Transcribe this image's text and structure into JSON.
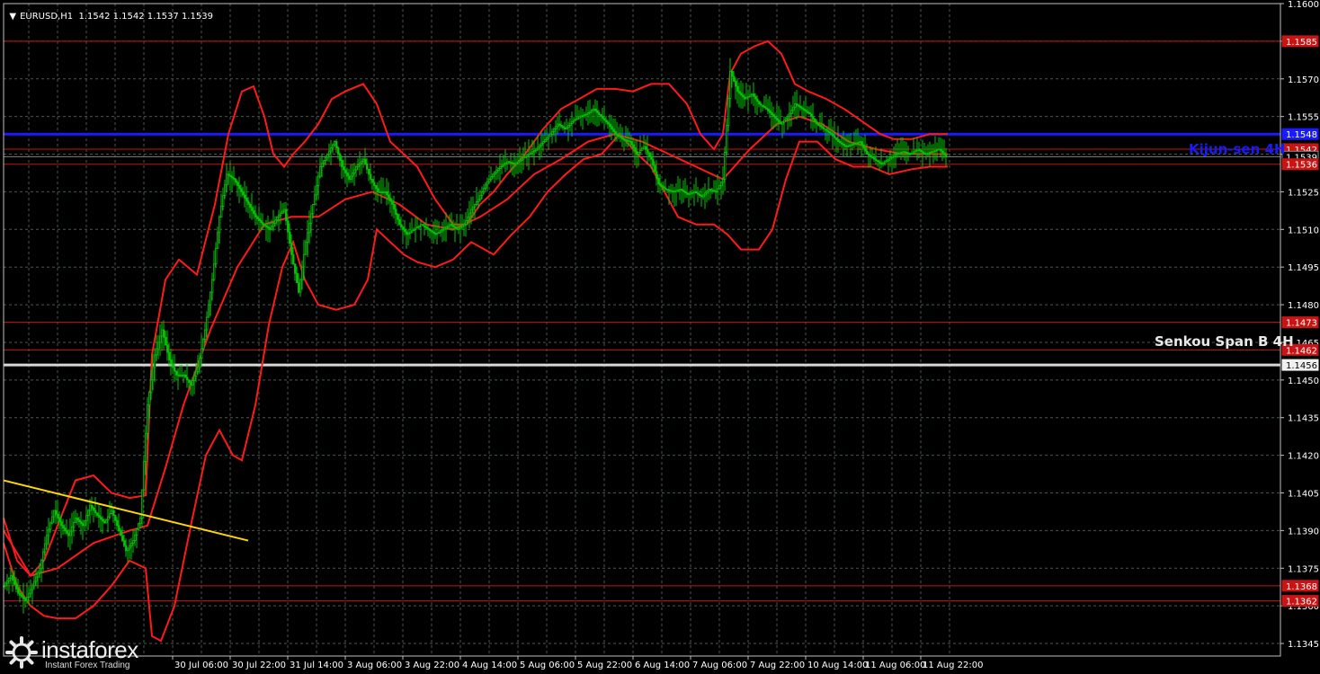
{
  "header": {
    "symbol": "EURUSD,H1",
    "ohlc": "1.1542 1.1542 1.1537 1.1539"
  },
  "logo": {
    "brand": "instaforex",
    "tagline": "Instant Forex Trading"
  },
  "colors": {
    "background": "#000000",
    "grid": "#4a5a4a",
    "candle": "#00c800",
    "bollinger": "#ff1a1a",
    "level_line": "#c81414",
    "kijun": "#1a1aff",
    "senkou": "#d8d8d8",
    "trendline": "#ffd700",
    "axis_text": "#ffffff"
  },
  "chart_data": {
    "type": "candlestick",
    "title": "EURUSD,H1",
    "ylim": [
      1.134,
      1.16
    ],
    "y_ticks": [
      "1.1600",
      "1.1585",
      "1.1570",
      "1.1555",
      "1.1540",
      "1.1525",
      "1.1510",
      "1.1495",
      "1.1480",
      "1.1465",
      "1.1450",
      "1.1435",
      "1.1420",
      "1.1405",
      "1.1390",
      "1.1375",
      "1.1360",
      "1.1345"
    ],
    "x_ticks": [
      "30 Jul 06:00",
      "30 Jul 22:00",
      "31 Jul 14:00",
      "3 Aug 06:00",
      "3 Aug 22:00",
      "4 Aug 14:00",
      "5 Aug 06:00",
      "5 Aug 22:00",
      "6 Aug 14:00",
      "7 Aug 06:00",
      "7 Aug 22:00",
      "10 Aug 14:00",
      "11 Aug 06:00",
      "11 Aug 22:00"
    ],
    "horizontal_levels": [
      {
        "label": "1.1585",
        "value": 1.1585,
        "kind": "level"
      },
      {
        "label": "1.1548",
        "value": 1.1548,
        "kind": "kijun"
      },
      {
        "label": "1.1542",
        "value": 1.1542,
        "kind": "level"
      },
      {
        "label": "1.1539",
        "value": 1.1539,
        "kind": "price"
      },
      {
        "label": "1.1536",
        "value": 1.1536,
        "kind": "level"
      },
      {
        "label": "1.1473",
        "value": 1.1473,
        "kind": "level"
      },
      {
        "label": "1.1462",
        "value": 1.1462,
        "kind": "level"
      },
      {
        "label": "1.1456",
        "value": 1.1456,
        "kind": "senkou"
      },
      {
        "label": "1.1368",
        "value": 1.1368,
        "kind": "level"
      },
      {
        "label": "1.1362",
        "value": 1.1362,
        "kind": "level"
      }
    ],
    "line_labels": {
      "kijun": "Kijun-sen 4H",
      "senkou": "Senkou Span B 4H"
    },
    "close_path": [
      [
        0,
        1.1368
      ],
      [
        8,
        1.1372
      ],
      [
        16,
        1.1365
      ],
      [
        24,
        1.1362
      ],
      [
        32,
        1.1368
      ],
      [
        40,
        1.1375
      ],
      [
        48,
        1.1388
      ],
      [
        56,
        1.1398
      ],
      [
        64,
        1.1392
      ],
      [
        72,
        1.1388
      ],
      [
        80,
        1.1395
      ],
      [
        88,
        1.1392
      ],
      [
        96,
        1.14
      ],
      [
        104,
        1.1396
      ],
      [
        112,
        1.1393
      ],
      [
        120,
        1.1398
      ],
      [
        128,
        1.139
      ],
      [
        136,
        1.1382
      ],
      [
        144,
        1.1386
      ],
      [
        152,
        1.1395
      ],
      [
        160,
        1.144
      ],
      [
        168,
        1.146
      ],
      [
        176,
        1.147
      ],
      [
        184,
        1.1458
      ],
      [
        192,
        1.1452
      ],
      [
        200,
        1.1452
      ],
      [
        208,
        1.1448
      ],
      [
        216,
        1.1455
      ],
      [
        224,
        1.147
      ],
      [
        232,
        1.149
      ],
      [
        240,
        1.1515
      ],
      [
        248,
        1.1532
      ],
      [
        256,
        1.153
      ],
      [
        264,
        1.1525
      ],
      [
        272,
        1.152
      ],
      [
        280,
        1.1515
      ],
      [
        288,
        1.1512
      ],
      [
        296,
        1.151
      ],
      [
        304,
        1.1515
      ],
      [
        312,
        1.1518
      ],
      [
        320,
        1.15
      ],
      [
        328,
        1.1485
      ],
      [
        336,
        1.1505
      ],
      [
        344,
        1.152
      ],
      [
        352,
        1.1535
      ],
      [
        360,
        1.154
      ],
      [
        368,
        1.1545
      ],
      [
        376,
        1.1535
      ],
      [
        384,
        1.153
      ],
      [
        392,
        1.1535
      ],
      [
        400,
        1.1538
      ],
      [
        408,
        1.153
      ],
      [
        416,
        1.1525
      ],
      [
        424,
        1.1525
      ],
      [
        432,
        1.152
      ],
      [
        440,
        1.1512
      ],
      [
        448,
        1.1508
      ],
      [
        456,
        1.151
      ],
      [
        464,
        1.1512
      ],
      [
        472,
        1.151
      ],
      [
        480,
        1.1508
      ],
      [
        488,
        1.151
      ],
      [
        496,
        1.1512
      ],
      [
        504,
        1.151
      ],
      [
        512,
        1.1512
      ],
      [
        520,
        1.1518
      ],
      [
        528,
        1.1522
      ],
      [
        536,
        1.1528
      ],
      [
        544,
        1.1532
      ],
      [
        552,
        1.1535
      ],
      [
        560,
        1.1537
      ],
      [
        568,
        1.1536
      ],
      [
        576,
        1.1538
      ],
      [
        584,
        1.154
      ],
      [
        592,
        1.1542
      ],
      [
        600,
        1.1545
      ],
      [
        608,
        1.1548
      ],
      [
        616,
        1.1552
      ],
      [
        624,
        1.155
      ],
      [
        632,
        1.1553
      ],
      [
        640,
        1.1555
      ],
      [
        648,
        1.1556
      ],
      [
        656,
        1.1558
      ],
      [
        664,
        1.1555
      ],
      [
        672,
        1.1552
      ],
      [
        680,
        1.1548
      ],
      [
        688,
        1.1546
      ],
      [
        696,
        1.1545
      ],
      [
        704,
        1.154
      ],
      [
        712,
        1.1543
      ],
      [
        720,
        1.1538
      ],
      [
        728,
        1.1528
      ],
      [
        736,
        1.1526
      ],
      [
        744,
        1.1525
      ],
      [
        752,
        1.1526
      ],
      [
        760,
        1.1524
      ],
      [
        768,
        1.1525
      ],
      [
        776,
        1.1523
      ],
      [
        784,
        1.1526
      ],
      [
        792,
        1.1525
      ],
      [
        800,
        1.153
      ],
      [
        808,
        1.1573
      ],
      [
        816,
        1.1565
      ],
      [
        824,
        1.1562
      ],
      [
        832,
        1.1564
      ],
      [
        840,
        1.156
      ],
      [
        848,
        1.1558
      ],
      [
        856,
        1.1555
      ],
      [
        864,
        1.1552
      ],
      [
        872,
        1.1555
      ],
      [
        880,
        1.156
      ],
      [
        888,
        1.1558
      ],
      [
        896,
        1.1556
      ],
      [
        904,
        1.1552
      ],
      [
        912,
        1.155
      ],
      [
        920,
        1.1548
      ],
      [
        928,
        1.1545
      ],
      [
        936,
        1.1543
      ],
      [
        944,
        1.1544
      ],
      [
        952,
        1.1545
      ],
      [
        960,
        1.154
      ],
      [
        968,
        1.1538
      ],
      [
        976,
        1.1536
      ],
      [
        984,
        1.1538
      ],
      [
        992,
        1.154
      ],
      [
        1000,
        1.1541
      ],
      [
        1008,
        1.154
      ],
      [
        1016,
        1.1542
      ],
      [
        1024,
        1.154
      ],
      [
        1032,
        1.1541
      ],
      [
        1040,
        1.1542
      ],
      [
        1048,
        1.1539
      ]
    ],
    "bollinger_upper": [
      [
        0,
        1.1395
      ],
      [
        15,
        1.1378
      ],
      [
        30,
        1.1372
      ],
      [
        45,
        1.1378
      ],
      [
        60,
        1.1392
      ],
      [
        80,
        1.141
      ],
      [
        100,
        1.1412
      ],
      [
        120,
        1.1405
      ],
      [
        140,
        1.1403
      ],
      [
        158,
        1.1404
      ],
      [
        165,
        1.146
      ],
      [
        180,
        1.149
      ],
      [
        195,
        1.1498
      ],
      [
        215,
        1.1492
      ],
      [
        235,
        1.152
      ],
      [
        250,
        1.1548
      ],
      [
        265,
        1.1565
      ],
      [
        278,
        1.1567
      ],
      [
        290,
        1.1555
      ],
      [
        300,
        1.154
      ],
      [
        312,
        1.1535
      ],
      [
        322,
        1.154
      ],
      [
        335,
        1.1545
      ],
      [
        350,
        1.1552
      ],
      [
        365,
        1.1562
      ],
      [
        380,
        1.1565
      ],
      [
        400,
        1.1568
      ],
      [
        415,
        1.156
      ],
      [
        430,
        1.1545
      ],
      [
        445,
        1.154
      ],
      [
        460,
        1.1535
      ],
      [
        480,
        1.1522
      ],
      [
        500,
        1.1512
      ],
      [
        515,
        1.1512
      ],
      [
        530,
        1.152
      ],
      [
        545,
        1.1525
      ],
      [
        560,
        1.1532
      ],
      [
        580,
        1.154
      ],
      [
        600,
        1.155
      ],
      [
        620,
        1.1558
      ],
      [
        640,
        1.1562
      ],
      [
        660,
        1.1566
      ],
      [
        680,
        1.1566
      ],
      [
        700,
        1.1565
      ],
      [
        720,
        1.1568
      ],
      [
        740,
        1.1568
      ],
      [
        760,
        1.156
      ],
      [
        775,
        1.1548
      ],
      [
        790,
        1.1542
      ],
      [
        800,
        1.1548
      ],
      [
        808,
        1.1572
      ],
      [
        820,
        1.158
      ],
      [
        835,
        1.1583
      ],
      [
        850,
        1.1585
      ],
      [
        865,
        1.158
      ],
      [
        880,
        1.1568
      ],
      [
        895,
        1.1565
      ],
      [
        915,
        1.1562
      ],
      [
        935,
        1.1558
      ],
      [
        955,
        1.1553
      ],
      [
        975,
        1.1548
      ],
      [
        990,
        1.1546
      ],
      [
        1010,
        1.1546
      ],
      [
        1030,
        1.1548
      ],
      [
        1050,
        1.1548
      ]
    ],
    "bollinger_lower": [
      [
        0,
        1.1385
      ],
      [
        15,
        1.1368
      ],
      [
        30,
        1.136
      ],
      [
        45,
        1.1356
      ],
      [
        60,
        1.1355
      ],
      [
        80,
        1.1355
      ],
      [
        100,
        1.136
      ],
      [
        120,
        1.1368
      ],
      [
        140,
        1.1378
      ],
      [
        158,
        1.1375
      ],
      [
        165,
        1.1348
      ],
      [
        175,
        1.1346
      ],
      [
        190,
        1.136
      ],
      [
        210,
        1.1395
      ],
      [
        225,
        1.142
      ],
      [
        240,
        1.143
      ],
      [
        255,
        1.142
      ],
      [
        265,
        1.1418
      ],
      [
        280,
        1.144
      ],
      [
        295,
        1.1472
      ],
      [
        310,
        1.1495
      ],
      [
        322,
        1.1505
      ],
      [
        335,
        1.149
      ],
      [
        350,
        1.148
      ],
      [
        370,
        1.1478
      ],
      [
        390,
        1.148
      ],
      [
        405,
        1.149
      ],
      [
        415,
        1.151
      ],
      [
        430,
        1.1505
      ],
      [
        445,
        1.15
      ],
      [
        460,
        1.1497
      ],
      [
        480,
        1.1495
      ],
      [
        500,
        1.1498
      ],
      [
        520,
        1.1505
      ],
      [
        545,
        1.15
      ],
      [
        565,
        1.1508
      ],
      [
        585,
        1.1515
      ],
      [
        605,
        1.1525
      ],
      [
        625,
        1.1532
      ],
      [
        645,
        1.1538
      ],
      [
        665,
        1.154
      ],
      [
        685,
        1.1548
      ],
      [
        705,
        1.154
      ],
      [
        720,
        1.1535
      ],
      [
        735,
        1.1525
      ],
      [
        750,
        1.1515
      ],
      [
        770,
        1.1512
      ],
      [
        790,
        1.1512
      ],
      [
        805,
        1.1508
      ],
      [
        820,
        1.1502
      ],
      [
        840,
        1.1502
      ],
      [
        855,
        1.151
      ],
      [
        870,
        1.153
      ],
      [
        885,
        1.1545
      ],
      [
        905,
        1.1545
      ],
      [
        925,
        1.1538
      ],
      [
        945,
        1.1535
      ],
      [
        965,
        1.1535
      ],
      [
        985,
        1.1532
      ],
      [
        1010,
        1.1534
      ],
      [
        1030,
        1.1535
      ],
      [
        1050,
        1.1535
      ]
    ],
    "bollinger_mid": [
      [
        0,
        1.139
      ],
      [
        30,
        1.1372
      ],
      [
        60,
        1.1375
      ],
      [
        100,
        1.1385
      ],
      [
        140,
        1.139
      ],
      [
        160,
        1.1392
      ],
      [
        180,
        1.1415
      ],
      [
        200,
        1.144
      ],
      [
        230,
        1.147
      ],
      [
        260,
        1.1495
      ],
      [
        290,
        1.1512
      ],
      [
        320,
        1.1515
      ],
      [
        350,
        1.1515
      ],
      [
        380,
        1.1522
      ],
      [
        410,
        1.1525
      ],
      [
        440,
        1.152
      ],
      [
        470,
        1.1512
      ],
      [
        500,
        1.151
      ],
      [
        530,
        1.1515
      ],
      [
        560,
        1.1522
      ],
      [
        590,
        1.1532
      ],
      [
        620,
        1.1538
      ],
      [
        650,
        1.1545
      ],
      [
        680,
        1.1548
      ],
      [
        710,
        1.1545
      ],
      [
        740,
        1.154
      ],
      [
        770,
        1.1535
      ],
      [
        800,
        1.153
      ],
      [
        830,
        1.1542
      ],
      [
        860,
        1.1552
      ],
      [
        885,
        1.1555
      ],
      [
        910,
        1.1552
      ],
      [
        940,
        1.1545
      ],
      [
        970,
        1.1542
      ],
      [
        1000,
        1.154
      ],
      [
        1030,
        1.154
      ],
      [
        1050,
        1.154
      ]
    ],
    "trendline": [
      [
        0,
        1.141
      ],
      [
        272,
        1.1386
      ]
    ]
  }
}
